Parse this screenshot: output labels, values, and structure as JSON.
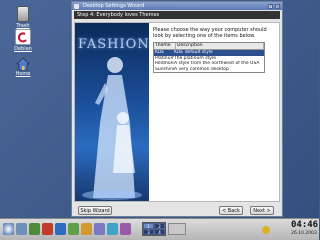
{
  "desktop": {
    "icons": [
      {
        "label": "Trash",
        "icon": "trash-icon"
      },
      {
        "label": "Debian",
        "icon": "debian-icon"
      },
      {
        "label": "Home",
        "icon": "home-icon"
      }
    ]
  },
  "window": {
    "title": "Desktop Settings Wizard",
    "step": "Step 4: Everybody loves Themes",
    "poster_text": "FASHION",
    "description": "Please choose the way your computer should look by selecting one of the items below.",
    "table": {
      "headers": [
        "Theme",
        "Description"
      ],
      "rows": [
        {
          "name": "KDE",
          "desc": "KDE default style"
        },
        {
          "name": "Platinum",
          "desc": "The platinum style"
        },
        {
          "name": "Redmond",
          "desc": "A style from the northwest of the USA"
        },
        {
          "name": "Sunshine",
          "desc": "A very common desktop"
        }
      ],
      "selected_index": 0
    },
    "buttons": {
      "skip": "Skip Wizard",
      "back": "< Back",
      "next": "Next >"
    }
  },
  "taskbar": {
    "pager": [
      "1",
      "2",
      "3",
      "4"
    ],
    "active_desktop": "1",
    "clock_time": "04:46",
    "clock_date": "26.10.2003"
  },
  "colors": {
    "desktop_bg": "#3d5a8a",
    "selection": "#2d4f8e",
    "titlebar": "#5b79b1"
  }
}
